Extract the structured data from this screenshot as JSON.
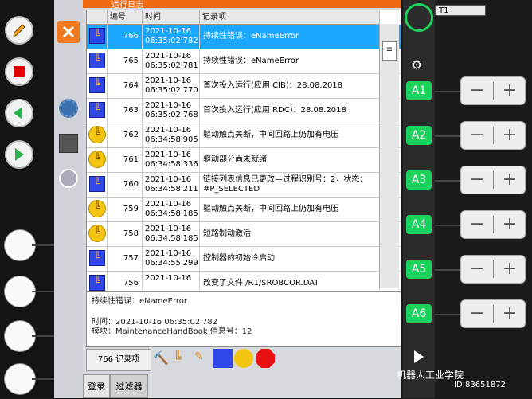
{
  "title": "运行日志",
  "left_rail": {
    "buttons": [
      "pencil-icon",
      "stop-icon",
      "step-back-icon",
      "step-forward-icon"
    ]
  },
  "table": {
    "headers": [
      "编号",
      "时间",
      "记录项"
    ],
    "rows": [
      {
        "num": "766",
        "date": "2021-10-16",
        "time": "06:35:02'782",
        "msg": "持续性错误：eNameError",
        "icon": "robot-blue"
      },
      {
        "num": "765",
        "date": "2021-10-16",
        "time": "06:35:02'781",
        "msg": "持续性错误：eNameError",
        "icon": "robot-blue"
      },
      {
        "num": "764",
        "date": "2021-10-16",
        "time": "06:35:02'770",
        "msg": "首次投入运行(应用 CIB)：28.08.2018",
        "icon": "robot-blue"
      },
      {
        "num": "763",
        "date": "2021-10-16",
        "time": "06:35:02'768",
        "msg": "首次投入运行(应用 RDC)：28.08.2018",
        "icon": "robot-blue"
      },
      {
        "num": "762",
        "date": "2021-10-16",
        "time": "06:34:58'905",
        "msg": "驱动触点关断，中间回路上仍加有电压",
        "icon": "robot-yellow"
      },
      {
        "num": "761",
        "date": "2021-10-16",
        "time": "06:34:58'336",
        "msg": "驱动部分尚未就绪",
        "icon": "robot-yellow"
      },
      {
        "num": "760",
        "date": "2021-10-16",
        "time": "06:34:58'211",
        "msg1": "链接列表信息已更改—过程识别号：2，状态：#P_SELECTED",
        "icon": "robot-blue"
      },
      {
        "num": "759",
        "date": "2021-10-16",
        "time": "06:34:58'185",
        "msg": "驱动触点关断，中间回路上仍加有电压",
        "icon": "robot-yellow"
      },
      {
        "num": "758",
        "date": "2021-10-16",
        "time": "06:34:58'185",
        "msg": "短路制动激活",
        "icon": "robot-yellow"
      },
      {
        "num": "757",
        "date": "2021-10-16",
        "time": "06:34:55'299",
        "msg": "控制器的初始冷启动",
        "icon": "robot-blue"
      },
      {
        "num": "756",
        "date": "2021-10-16",
        "time": "",
        "msg": "改变了文件 /R1/$ROBCOR.DAT",
        "icon": "robot-blue"
      }
    ]
  },
  "detail": {
    "line1": "持续性错误：eNameError",
    "line2": "时间：2021-10-16 06:35:02'782",
    "line3": "模块：MaintenanceHandBook  信息号：12"
  },
  "count_label": "766 记录项",
  "tabs": [
    "登录",
    "过滤器"
  ],
  "dropdown": "T1",
  "axes": [
    "A1",
    "A2",
    "A3",
    "A4",
    "A5",
    "A6"
  ],
  "watermark": "机器人工业学院",
  "watermark_id": "ID:83651872"
}
